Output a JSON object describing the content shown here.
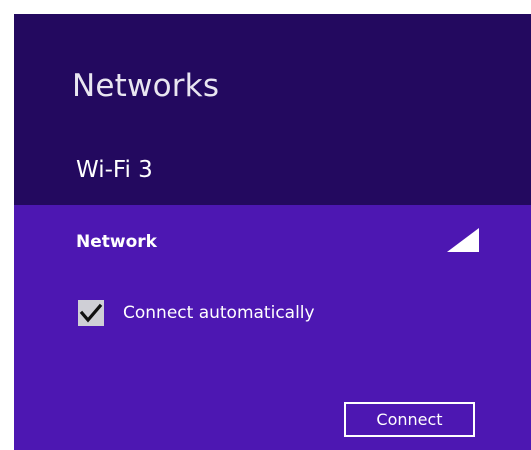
{
  "colors": {
    "header_bg": "#23095f",
    "body_bg": "#4d17b2",
    "text": "#ffffff",
    "checkbox_bg": "#cfcfd6"
  },
  "panel": {
    "title": "Networks",
    "selected_network": "Wi-Fi 3"
  },
  "network": {
    "name": "Network",
    "signal_icon": "signal-strength-icon",
    "connect_automatically": {
      "label": "Connect automatically",
      "checked": true
    },
    "connect_button_label": "Connect"
  }
}
